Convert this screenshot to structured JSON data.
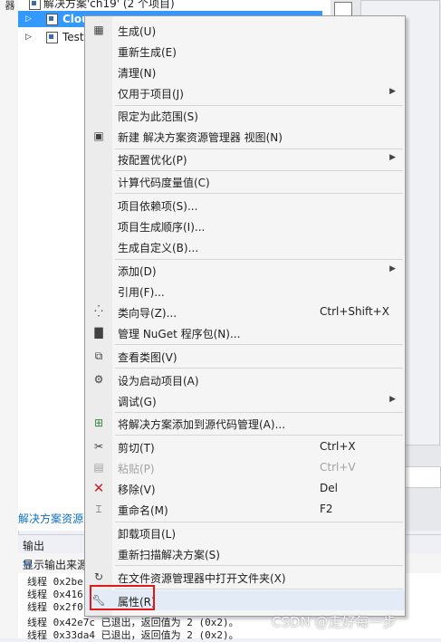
{
  "window": {
    "left_strip_text": "器"
  },
  "solution_explorer": {
    "solution_label": "解决方案'ch19' (2 个项目)",
    "selected_project": "Clou",
    "other_project": "Test",
    "footer_tab": "解决方案资源"
  },
  "output": {
    "title": "输出",
    "source_label": "显示输出来源",
    "lines": [
      "线程 0x2be",
      "线程 0x416",
      "线程 0x2f0",
      "线程 0x42e7c 已退出，返回值为 2 (0x2)。",
      "线程 0x33da4 已退出，返回值为 2 (0x2)。"
    ]
  },
  "context_menu": {
    "items": [
      {
        "label": "生成(U)",
        "icon": "build-icon"
      },
      {
        "label": "重新生成(E)"
      },
      {
        "label": "清理(N)"
      },
      {
        "label": "仅用于项目(J)",
        "submenu": true
      },
      {
        "label": "限定为此范围(S)"
      },
      {
        "label": "新建 解决方案资源管理器 视图(N)",
        "icon": "new-view-icon"
      },
      {
        "label": "按配置优化(P)",
        "submenu": true
      },
      {
        "label": "计算代码度量值(C)"
      },
      {
        "label": "项目依赖项(S)..."
      },
      {
        "label": "项目生成顺序(I)..."
      },
      {
        "label": "生成自定义(B)..."
      },
      {
        "label": "添加(D)",
        "submenu": true
      },
      {
        "label": "引用(F)..."
      },
      {
        "label": "类向导(Z)...",
        "shortcut": "Ctrl+Shift+X",
        "icon": "class-wizard-icon"
      },
      {
        "label": "管理 NuGet 程序包(N)...",
        "icon": "nuget-icon"
      },
      {
        "label": "查看类图(V)",
        "icon": "class-diagram-icon"
      },
      {
        "label": "设为启动项目(A)",
        "icon": "gear-icon"
      },
      {
        "label": "调试(G)",
        "submenu": true
      },
      {
        "label": "将解决方案添加到源代码管理(A)...",
        "icon": "source-control-icon"
      },
      {
        "label": "剪切(T)",
        "shortcut": "Ctrl+X",
        "icon": "scissors-icon"
      },
      {
        "label": "粘贴(P)",
        "shortcut": "Ctrl+V",
        "icon": "paste-icon",
        "disabled": true
      },
      {
        "label": "移除(V)",
        "shortcut": "Del",
        "icon": "remove-icon"
      },
      {
        "label": "重命名(M)",
        "shortcut": "F2",
        "icon": "rename-icon"
      },
      {
        "label": "卸载项目(L)"
      },
      {
        "label": "重新扫描解决方案(S)"
      },
      {
        "label": "在文件资源管理器中打开文件夹(X)",
        "icon": "refresh-icon"
      },
      {
        "label": "属性(R)",
        "icon": "wrench-icon",
        "selected": true
      }
    ]
  },
  "watermark": "CSDN @走好每一步",
  "colors": {
    "selection_blue": "#3399ff",
    "menu_background": "#f5f5f5",
    "highlight_red": "#e0191b",
    "link_blue": "#0e70c0"
  }
}
